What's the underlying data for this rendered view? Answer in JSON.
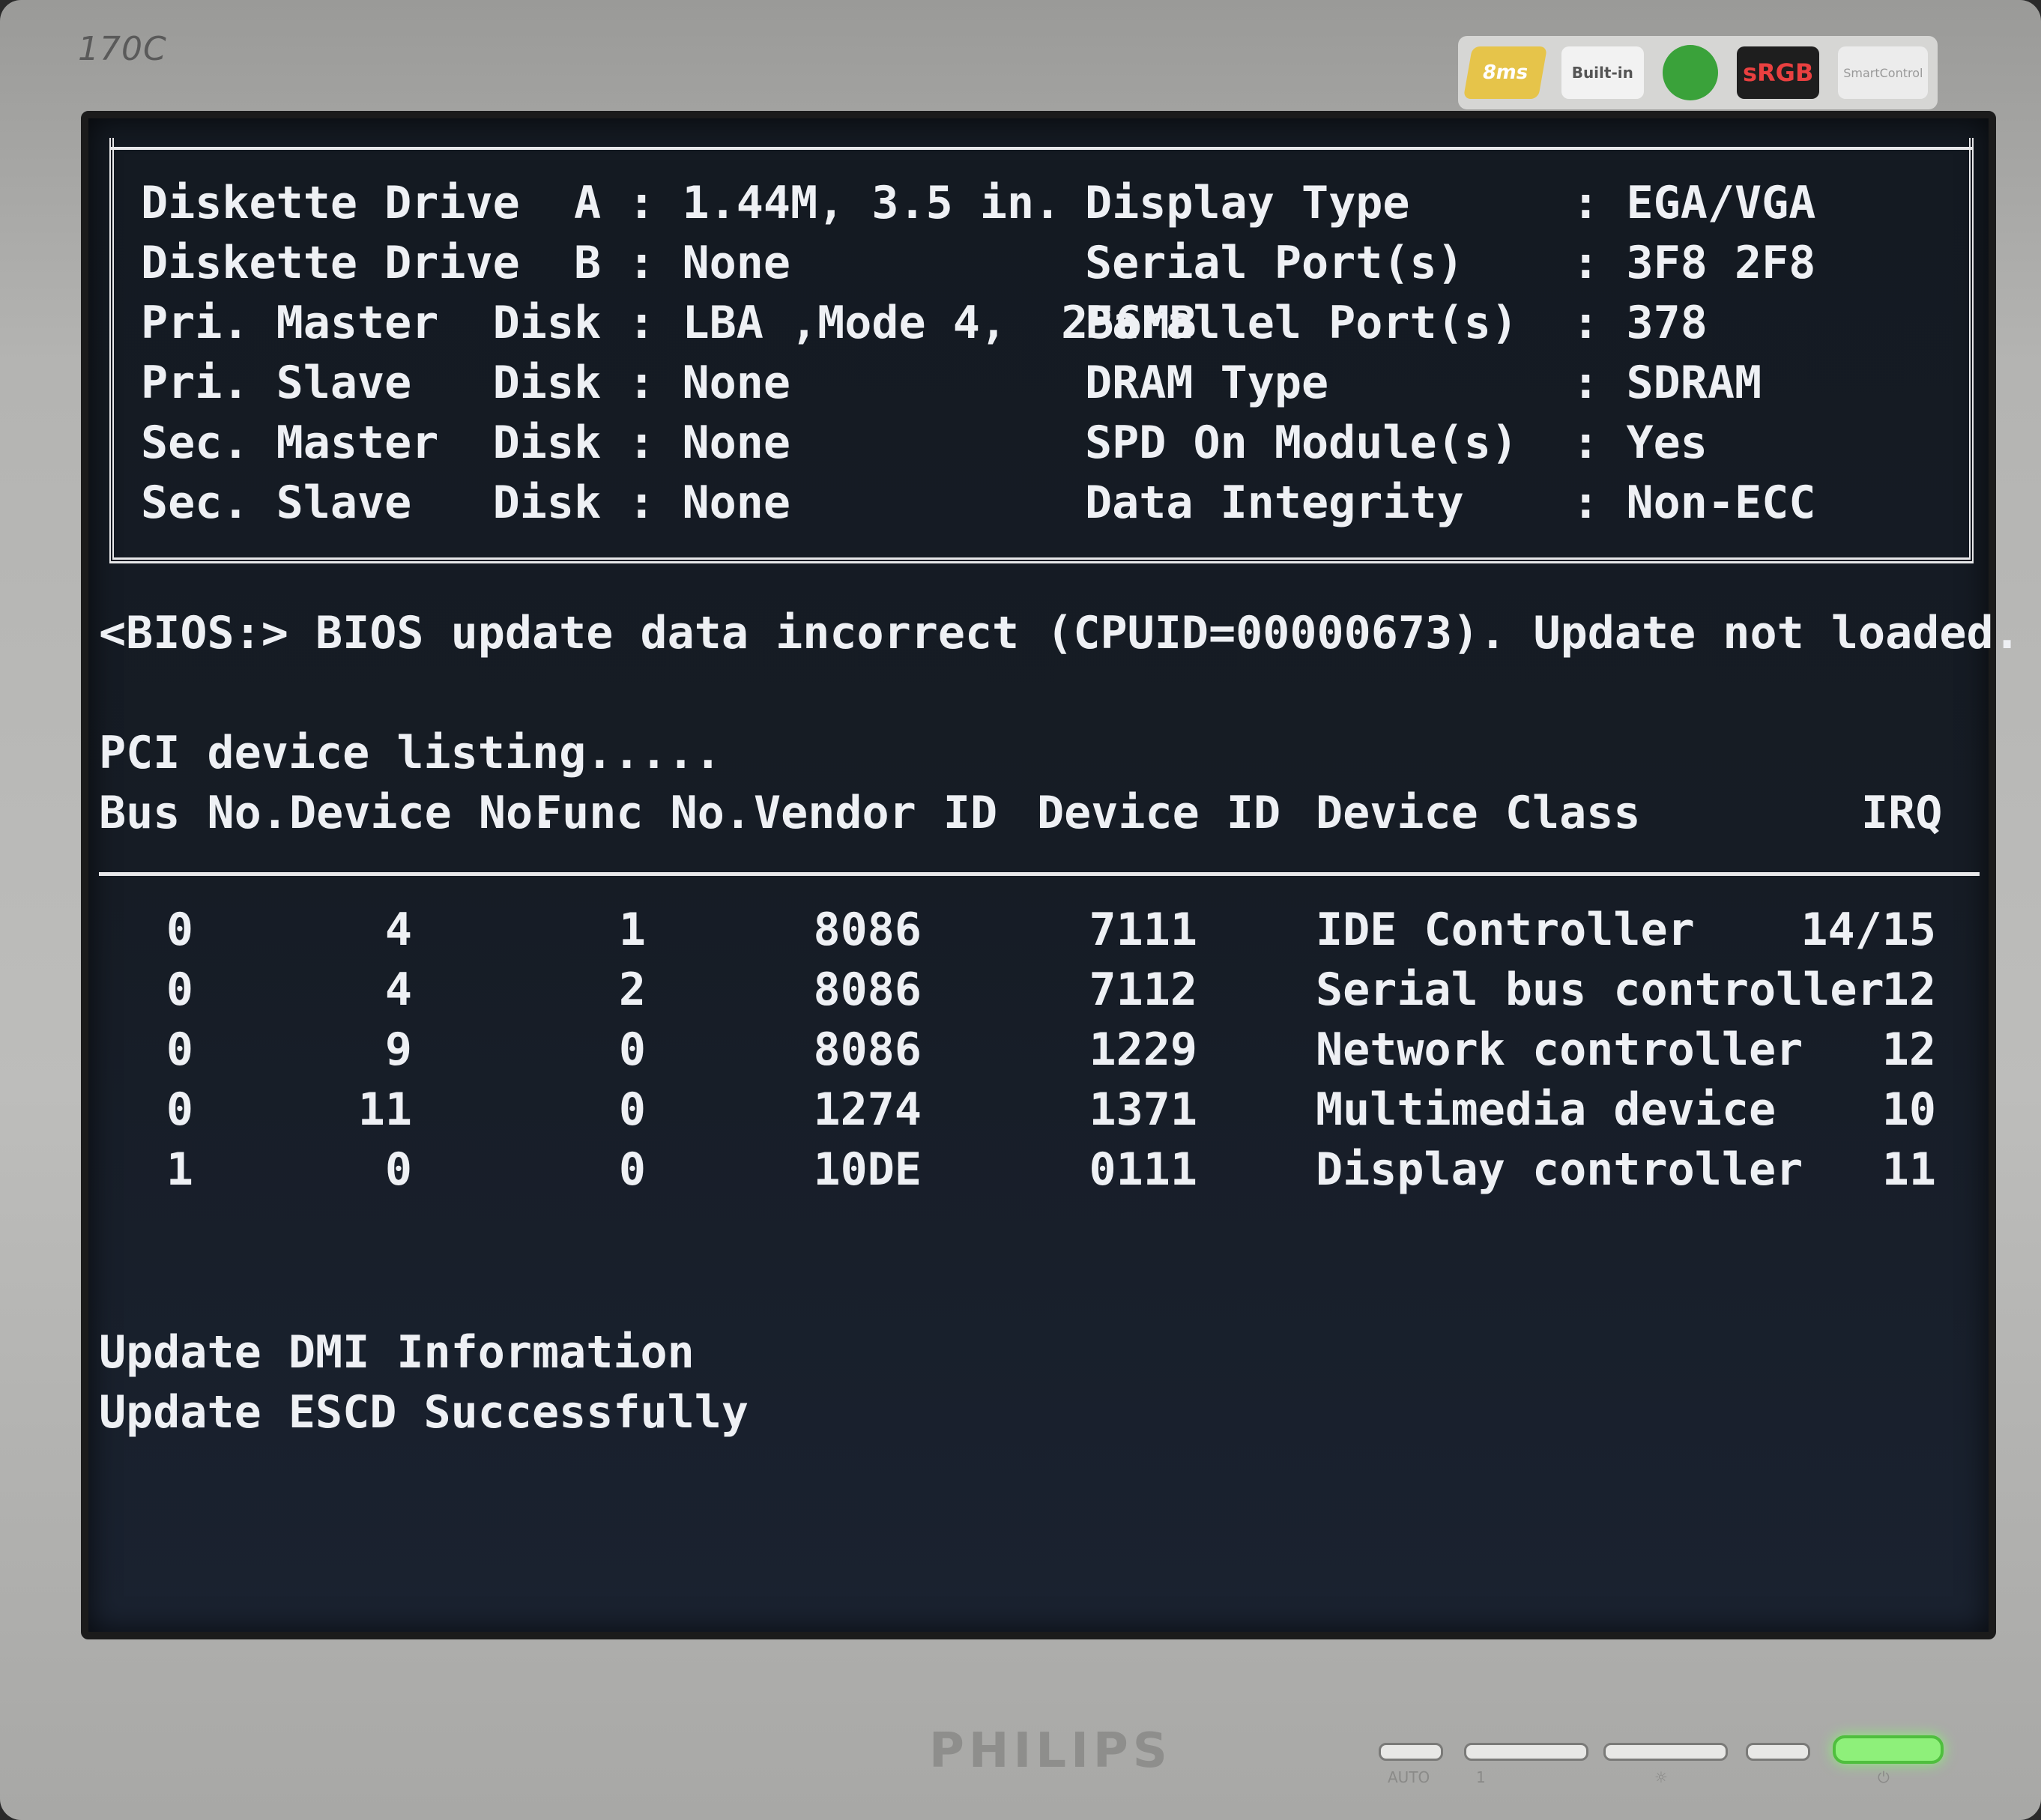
{
  "monitor": {
    "model": "170C",
    "brand": "PHILIPS",
    "badges": [
      "8ms",
      "Built-in",
      "sRGB",
      "SmartControl"
    ],
    "controls": [
      "AUTO",
      "1",
      "☼",
      "⏻"
    ]
  },
  "hw": {
    "left": [
      "Diskette Drive  A : 1.44M, 3.5 in.",
      "Diskette Drive  B : None",
      "Pri. Master  Disk : LBA ,Mode 4,  256MB",
      "Pri. Slave   Disk : None",
      "Sec. Master  Disk : None",
      "Sec. Slave   Disk : None"
    ],
    "right": [
      "Display Type      : EGA/VGA",
      "Serial Port(s)    : 3F8 2F8",
      "Parallel Port(s)  : 378",
      "DRAM Type         : SDRAM",
      "SPD On Module(s)  : Yes",
      "Data Integrity    : Non-ECC"
    ]
  },
  "bios_msg": "<BIOS:> BIOS update data incorrect (CPUID=00000673). Update not loaded.",
  "pci": {
    "title": "PCI device listing.....",
    "headers": [
      "Bus No.",
      "Device No.",
      "Func No.",
      "Vendor ID",
      "Device ID",
      "Device Class",
      "IRQ"
    ],
    "rows": [
      [
        "0",
        "4",
        "1",
        "8086",
        "7111",
        "IDE Controller",
        "14/15"
      ],
      [
        "0",
        "4",
        "2",
        "8086",
        "7112",
        "Serial bus controller",
        "12"
      ],
      [
        "0",
        "9",
        "0",
        "8086",
        "1229",
        "Network controller",
        "12"
      ],
      [
        "0",
        "11",
        "0",
        "1274",
        "1371",
        "Multimedia device",
        "10"
      ],
      [
        "1",
        "0",
        "0",
        "10DE",
        "0111",
        "Display controller",
        "11"
      ]
    ]
  },
  "footer": [
    "Update DMI Information",
    "Update ESCD Successfully"
  ]
}
